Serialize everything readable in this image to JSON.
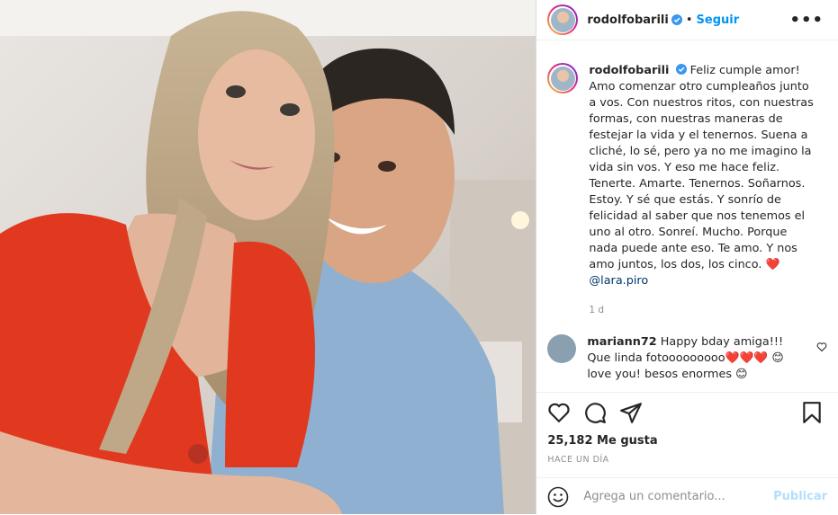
{
  "post": {
    "username": "rodolfobarili",
    "follow_label": "Seguir",
    "more_label": "•••",
    "caption": "Feliz cumple amor! Amo comenzar otro cumpleaños junto a vos. Con nuestros ritos, con nuestras formas, con nuestras maneras de festejar la vida y el tenernos. Suena a cliché, lo sé, pero ya no me imagino la vida sin vos. Y eso me hace feliz. Tenerte. Amarte. Tenernos. Soñarnos. Estoy. Y sé que estás. Y sonrío de felicidad al saber que nos tenemos el uno al otro. Sonreí. Mucho. Porque nada puede ante eso. Te amo. Y nos amo juntos, los dos, los cinco. ❤️",
    "mention": "@lara.piro",
    "caption_age": "1 d",
    "likes": "25,182 Me gusta",
    "time_ago": "HACE UN DÍA",
    "comment_placeholder": "Agrega un comentario...",
    "publish_label": "Publicar"
  },
  "comments": [
    {
      "username": "mariann72",
      "text": "Happy bday amiga!!! Que linda fotooooooooo❤️❤️❤️ 😊 love you! besos enormes 😊"
    }
  ],
  "icons": [
    "verified-icon",
    "more-icon",
    "heart-icon",
    "comment-icon",
    "share-icon",
    "save-icon",
    "emoji-icon"
  ],
  "colors": {
    "accent": "#0095f6",
    "publish_disabled": "#b2dffc",
    "verified": "#3897f0"
  }
}
